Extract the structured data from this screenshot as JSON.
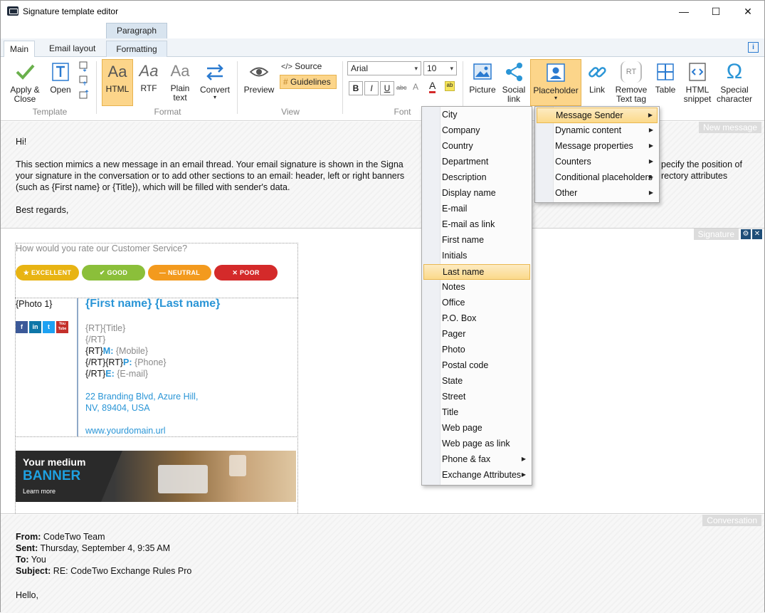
{
  "window": {
    "title": "Signature template editor",
    "controls": [
      "—",
      "☐",
      "✕"
    ]
  },
  "context_tab_header": "Paragraph",
  "tabs": [
    "Main",
    "Email layout",
    "Formatting"
  ],
  "ribbon": {
    "template": {
      "group_label": "Template",
      "apply_close": "Apply &\nClose",
      "open": "Open"
    },
    "format": {
      "group_label": "Format",
      "html": "HTML",
      "rtf": "RTF",
      "plain_text": "Plain\ntext",
      "convert": "Convert",
      "aa": "Aa"
    },
    "view": {
      "group_label": "View",
      "preview": "Preview",
      "source": "Source",
      "guidelines": "Guidelines"
    },
    "font": {
      "group_label": "Font",
      "family": "Arial",
      "size": "10",
      "bold": "B",
      "italic": "I",
      "underline": "U",
      "strike": "abc",
      "color_a": "A"
    },
    "insert": {
      "picture": "Picture",
      "social_link": "Social\nlink",
      "placeholder": "Placeholder",
      "link": "Link",
      "remove_text_tag": "Remove\nText tag",
      "table": "Table",
      "html_snippet": "HTML\nsnippet",
      "special_character": "Special\ncharacter",
      "rt_icon": "RT"
    }
  },
  "new_message": {
    "tag": "New message",
    "greeting": "Hi!",
    "body_line1_a": "This section mimics a new message in an email thread. Your email signature is shown in the Signa",
    "body_line1_b": "pecify the position of",
    "body_line2_a": "your signature in the conversation or to add other sections to an email: header, left or right banners",
    "body_line2_b": "rectory attributes",
    "body_line3": "(such as {First name} or {Title}), which will be filled with sender's data.",
    "closing": "Best regards,"
  },
  "signature": {
    "tag": "Signature",
    "settings_icon": "⚙",
    "close_icon": "✕",
    "rate_question": "How would you rate our Customer Service?",
    "ratings": [
      {
        "label": "EXCELLENT",
        "symbol": "★",
        "color": "#e8b413"
      },
      {
        "label": "GOOD",
        "symbol": "✔",
        "color": "#8bbf3a"
      },
      {
        "label": "NEUTRAL",
        "symbol": "—",
        "color": "#f39a1e"
      },
      {
        "label": "POOR",
        "symbol": "✕",
        "color": "#d42a2a"
      }
    ],
    "photo": "{Photo 1}",
    "social": [
      {
        "label": "f",
        "color": "#3b5998"
      },
      {
        "label": "in",
        "color": "#0e76a8"
      },
      {
        "label": "t",
        "color": "#1da1f2"
      },
      {
        "label": "You\nTube",
        "color": "#c4302b"
      }
    ],
    "name": "{First name} {Last name}",
    "title_line": "{RT}{Title}",
    "rt_close_1": "{/RT}",
    "mobile_open": "{RT}",
    "mobile_label": "M:",
    "mobile_value": "{Mobile}",
    "phone_open": "{/RT}{RT}",
    "phone_label": "P:",
    "phone_value": "{Phone}",
    "email_open": "{/RT}",
    "email_label": "E:",
    "email_value": "{E-mail}",
    "address_1": "22 Branding Blvd, Azure Hill,",
    "address_2": "NV, 89404, USA",
    "website": "www.yourdomain.url",
    "banner_line1": "Your medium",
    "banner_line2": "BANNER",
    "banner_line3": "Learn more"
  },
  "conversation": {
    "tag": "Conversation",
    "from_label": "From:",
    "from_value": "CodeTwo Team",
    "sent_label": "Sent:",
    "sent_value": "Thursday, September 4, 9:35 AM",
    "to_label": "To:",
    "to_value": "You",
    "subject_label": "Subject:",
    "subject_value": "RE: CodeTwo Exchange Rules Pro",
    "greeting": "Hello,"
  },
  "placeholder_menu": {
    "items": [
      {
        "label": "Message Sender",
        "submenu": true,
        "selected": true
      },
      {
        "label": "Dynamic content",
        "submenu": true
      },
      {
        "label": "Message properties",
        "submenu": true
      },
      {
        "label": "Counters",
        "submenu": true
      },
      {
        "label": "Conditional placeholders",
        "submenu": true
      },
      {
        "label": "Other",
        "submenu": true
      }
    ]
  },
  "sender_submenu": {
    "items": [
      {
        "label": "City"
      },
      {
        "label": "Company"
      },
      {
        "label": "Country"
      },
      {
        "label": "Department"
      },
      {
        "label": "Description"
      },
      {
        "label": "Display name"
      },
      {
        "label": "E-mail"
      },
      {
        "label": "E-mail as link"
      },
      {
        "label": "First name"
      },
      {
        "label": "Initials"
      },
      {
        "label": "Last name",
        "selected": true
      },
      {
        "label": "Notes"
      },
      {
        "label": "Office"
      },
      {
        "label": "P.O. Box"
      },
      {
        "label": "Pager"
      },
      {
        "label": "Photo"
      },
      {
        "label": "Postal code"
      },
      {
        "label": "State"
      },
      {
        "label": "Street"
      },
      {
        "label": "Title"
      },
      {
        "label": "Web page"
      },
      {
        "label": "Web page as link"
      },
      {
        "label": "Phone & fax",
        "submenu": true
      },
      {
        "label": "Exchange Attributes",
        "submenu": true
      }
    ]
  },
  "submenu_arrow": "▶"
}
